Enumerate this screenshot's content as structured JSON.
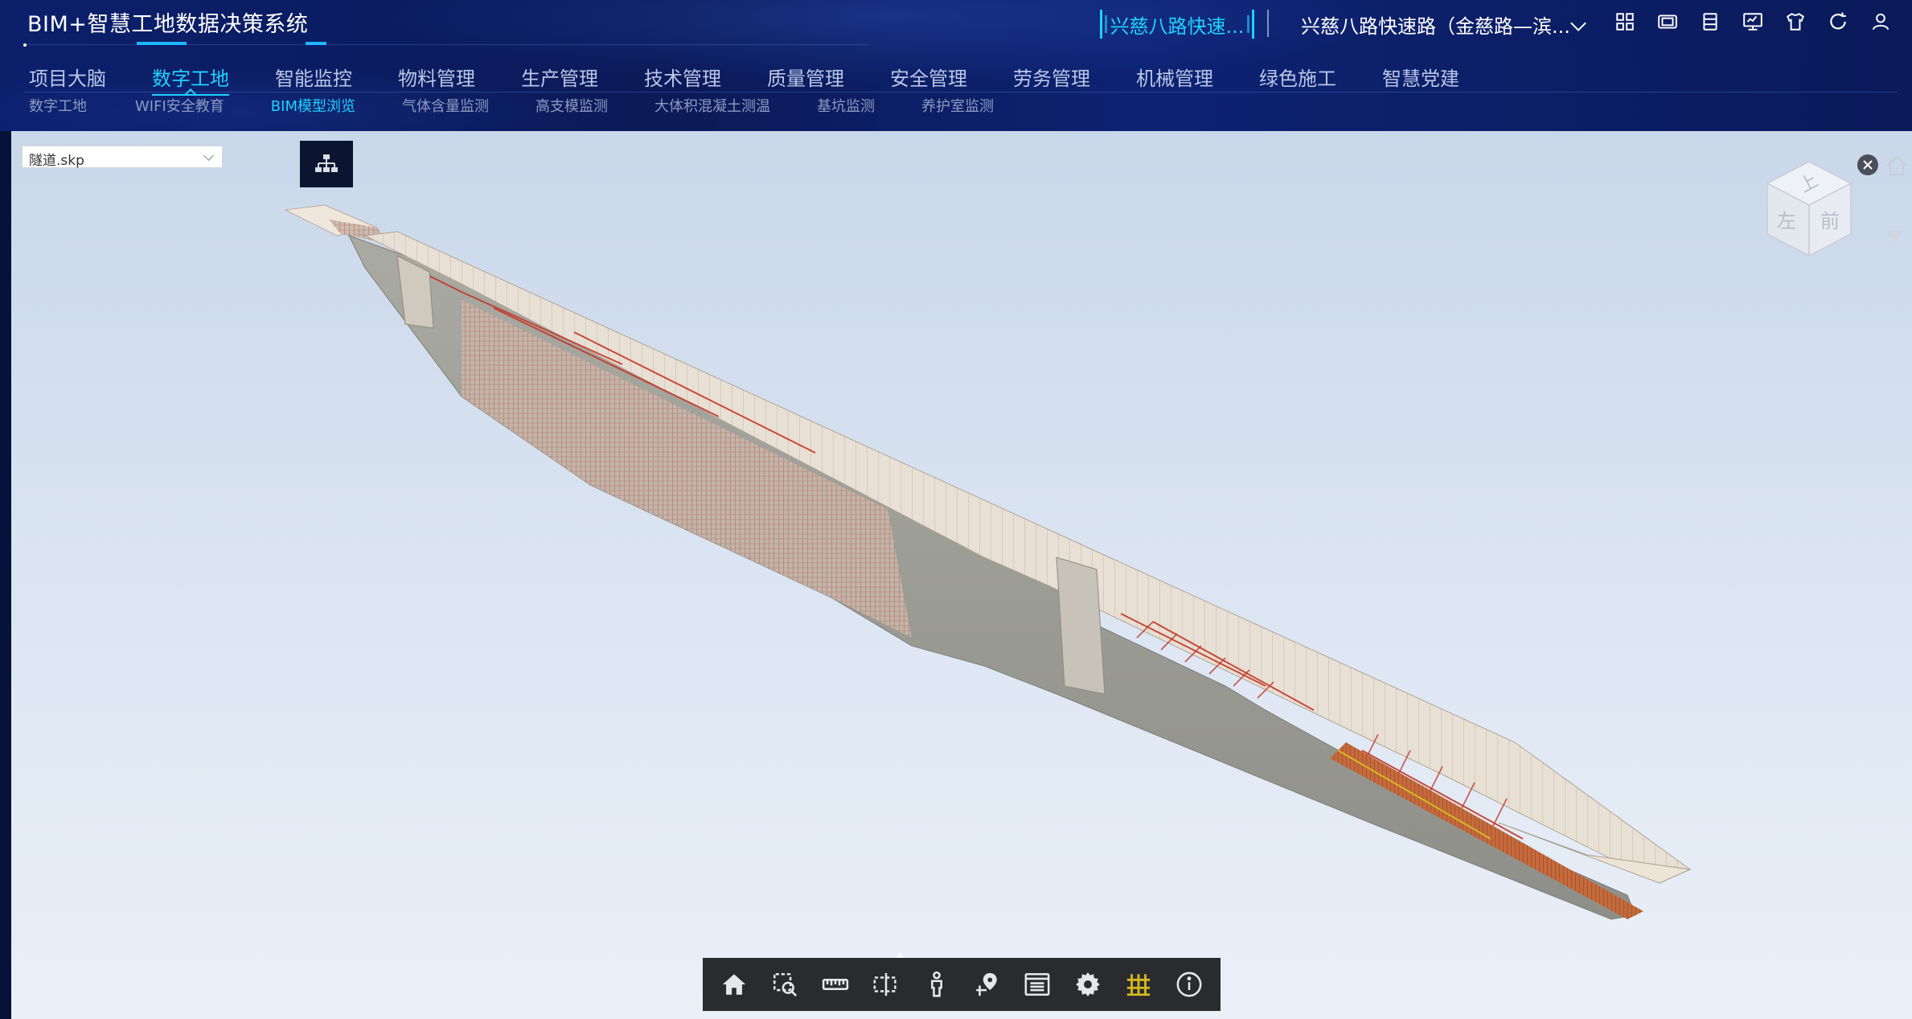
{
  "app": {
    "title": "BIM+智慧工地数据决策系统"
  },
  "header": {
    "project_short": "兴慈八路快速...",
    "project_select": "兴慈八路快速路（金慈路—滨..."
  },
  "top_icons": [
    "grid-icon",
    "screen-icon",
    "list-icon",
    "monitor-icon",
    "shirt-icon",
    "refresh-icon",
    "user-icon"
  ],
  "nav": {
    "items": [
      {
        "label": "项目大脑"
      },
      {
        "label": "数字工地"
      },
      {
        "label": "智能监控"
      },
      {
        "label": "物料管理"
      },
      {
        "label": "生产管理"
      },
      {
        "label": "技术管理"
      },
      {
        "label": "质量管理"
      },
      {
        "label": "安全管理"
      },
      {
        "label": "劳务管理"
      },
      {
        "label": "机械管理"
      },
      {
        "label": "绿色施工"
      },
      {
        "label": "智慧党建"
      }
    ],
    "active_index": 1
  },
  "subnav": {
    "items": [
      {
        "label": "数字工地"
      },
      {
        "label": "WIFI安全教育"
      },
      {
        "label": "BIM模型浏览"
      },
      {
        "label": "气体含量监测"
      },
      {
        "label": "高支模监测"
      },
      {
        "label": "大体积混凝土测温"
      },
      {
        "label": "基坑监测"
      },
      {
        "label": "养护室监测"
      }
    ],
    "active_index": 2
  },
  "viewer": {
    "file": "隧道.skp",
    "cube_labels": {
      "top": "上",
      "left": "左",
      "front": "前"
    }
  },
  "toolbar": {
    "tools": [
      "home-icon",
      "zoom-box-icon",
      "measure-icon",
      "section-box-icon",
      "walk-person-icon",
      "location-pin-icon",
      "properties-list-icon",
      "settings-gear-icon",
      "model-structure-icon",
      "info-icon"
    ]
  },
  "colors": {
    "accent": "#1fd2ff",
    "header_bg": "#0b1f6b",
    "toolbar_bg": "#2a2b2f",
    "highlight": "#d4b820"
  }
}
